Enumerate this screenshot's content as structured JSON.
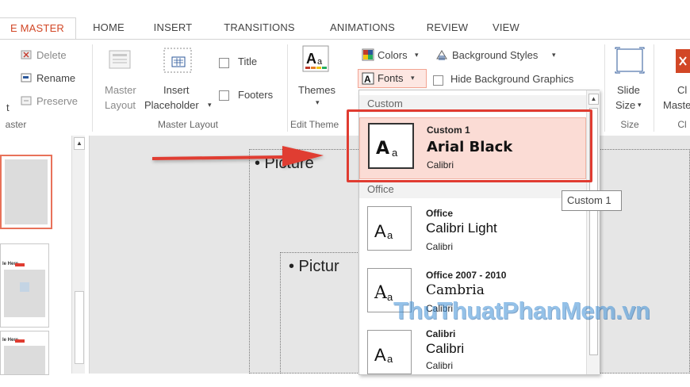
{
  "tabs": [
    {
      "label": "E MASTER"
    },
    {
      "label": "HOME"
    },
    {
      "label": "INSERT"
    },
    {
      "label": "TRANSITIONS"
    },
    {
      "label": "ANIMATIONS"
    },
    {
      "label": "REVIEW"
    },
    {
      "label": "VIEW"
    }
  ],
  "ribbon": {
    "edit_master": {
      "delete": "Delete",
      "rename": "Rename",
      "preserve": "Preserve",
      "partial_t": "t",
      "group": "aster"
    },
    "master_layout": {
      "master_layout_1": "Master",
      "master_layout_2": "Layout",
      "insert_ph_1": "Insert",
      "insert_ph_2": "Placeholder",
      "title": "Title",
      "footers": "Footers",
      "group": "Master Layout"
    },
    "edit_theme": {
      "themes": "Themes",
      "group": "Edit Theme"
    },
    "background": {
      "colors": "Colors",
      "fonts": "Fonts",
      "bg_styles": "Background Styles",
      "hide_bg": "Hide Background Graphics",
      "group_fragment": "s"
    },
    "size": {
      "slide_size_1": "Slide",
      "slide_size_2": "Size",
      "group": "Size"
    },
    "close": {
      "close_1": "Cl",
      "close_2": "Maste",
      "group": "Cl"
    }
  },
  "slide": {
    "text1": "• Picture",
    "text2": "• Pictur"
  },
  "fonts_dropdown": {
    "section_custom": "Custom",
    "section_office": "Office",
    "items": [
      {
        "name": "Custom 1",
        "heading": "Arial Black",
        "body": "Calibri",
        "glyph_big": "A",
        "glyph_small": "a"
      },
      {
        "name": "Office",
        "heading": "Calibri Light",
        "body": "Calibri",
        "glyph_big": "A",
        "glyph_small": "a"
      },
      {
        "name": "Office 2007 - 2010",
        "heading": "Cambria",
        "body": "Calibri",
        "glyph_big": "A",
        "glyph_small": "a"
      },
      {
        "name": "Calibri",
        "heading": "Calibri",
        "body": "Calibri",
        "glyph_big": "A",
        "glyph_small": "a"
      }
    ]
  },
  "tooltip": "Custom 1",
  "watermark": "ThuThuatPhanMem.vn",
  "thumb_label_1": "le Here",
  "thumb_label_2": "le Here",
  "colors": {
    "accent": "#d24726",
    "highlight_red": "#e03c31",
    "selection_bg": "#fbdcd5"
  }
}
